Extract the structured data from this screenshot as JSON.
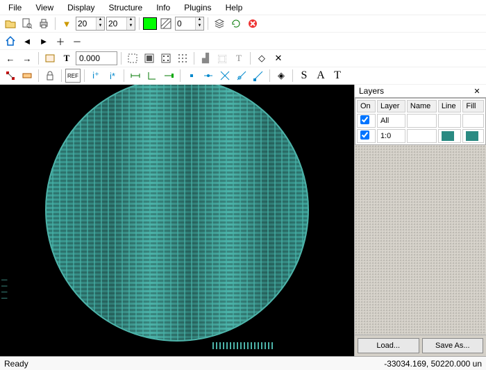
{
  "menu": {
    "file": "File",
    "view": "View",
    "display": "Display",
    "structure": "Structure",
    "info": "Info",
    "plugins": "Plugins",
    "help": "Help"
  },
  "toolbar1": {
    "spin1": "20",
    "spin2": "20",
    "color_fill": "#00ff00",
    "spin3": "0"
  },
  "toolbar3": {
    "coord": "0.000"
  },
  "layers": {
    "title": "Layers",
    "headers": {
      "on": "On",
      "layer": "Layer",
      "name": "Name",
      "line": "Line",
      "fill": "Fill"
    },
    "rows": [
      {
        "on": true,
        "layer": "All",
        "name": "",
        "line": "",
        "fill": ""
      },
      {
        "on": true,
        "layer": "1:0",
        "name": "",
        "line": "#2a8a82",
        "fill": "#2a8a82"
      }
    ],
    "load": "Load...",
    "save": "Save As..."
  },
  "status": {
    "left": "Ready",
    "right": "-33034.169, 50220.000 un"
  }
}
